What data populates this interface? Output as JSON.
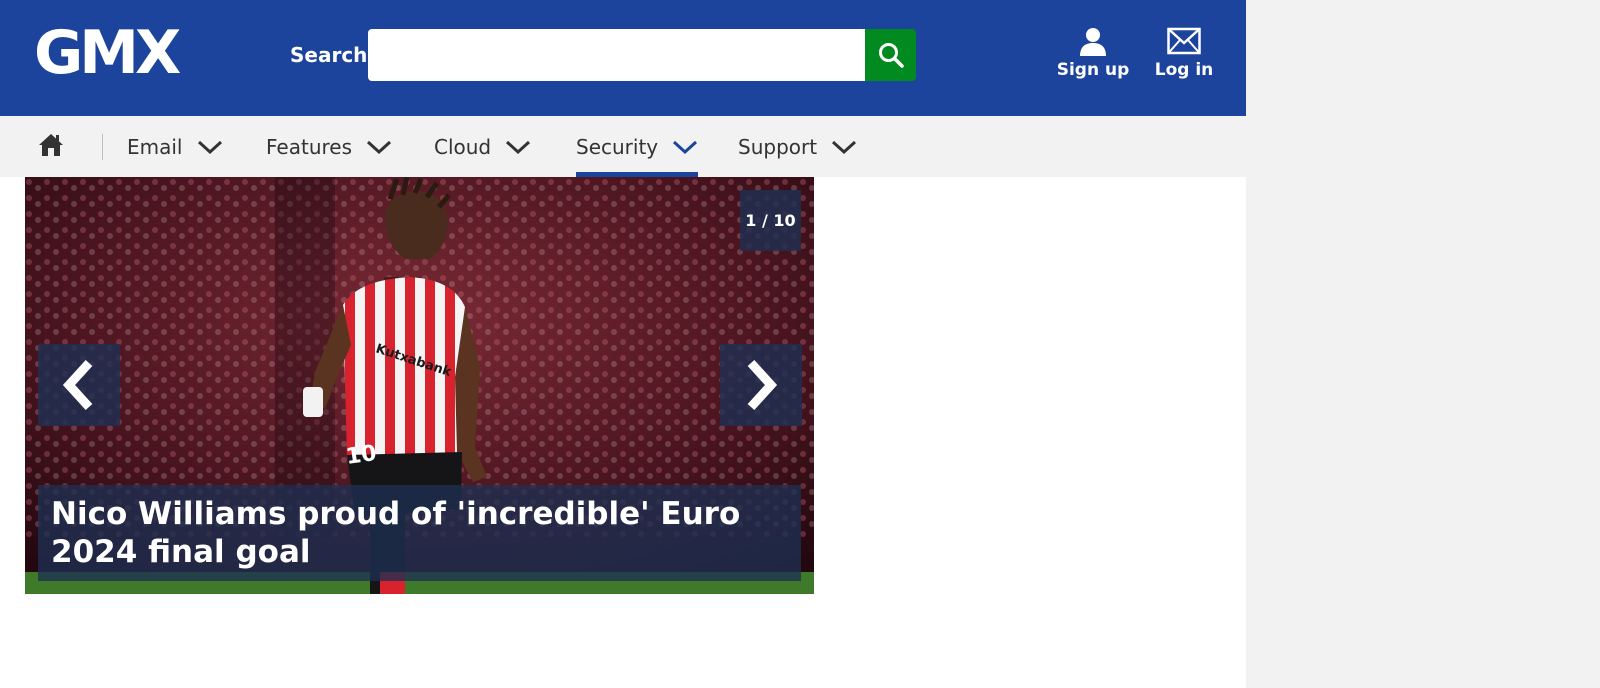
{
  "header": {
    "logo_text": "GMX",
    "search_label": "Search",
    "search_placeholder": "",
    "search_value": "",
    "signup_label": "Sign up",
    "login_label": "Log in",
    "brand_color": "#1d449c",
    "search_button_color": "#008a1f"
  },
  "nav": {
    "items": [
      {
        "label": "Email"
      },
      {
        "label": "Features"
      },
      {
        "label": "Cloud"
      },
      {
        "label": "Security",
        "active": true
      },
      {
        "label": "Support"
      }
    ]
  },
  "carousel": {
    "counter": "1 / 10",
    "current": 1,
    "total": 10,
    "caption": "Nico Williams proud of 'incredible' Euro 2024 final goal",
    "shirt_number": "10",
    "sponsor_text": "Kutxabank"
  },
  "icons": {
    "search": "search-icon",
    "signup": "user-icon",
    "login": "envelope-icon",
    "home": "home-icon",
    "prev": "chevron-left-icon",
    "next": "chevron-right-icon",
    "dropdown": "chevron-down-icon"
  }
}
